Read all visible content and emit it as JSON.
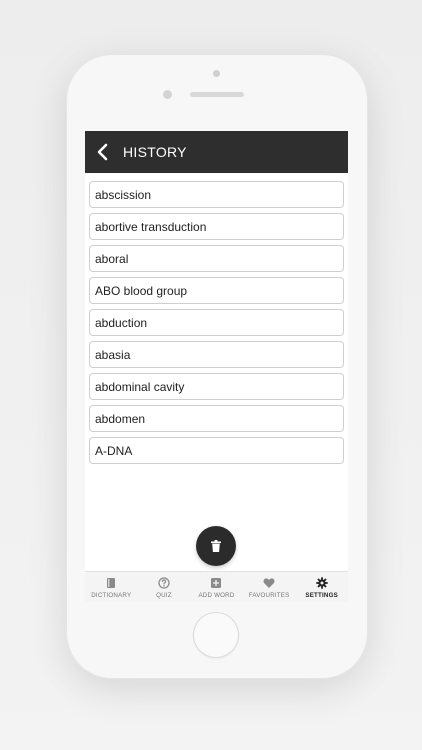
{
  "header": {
    "title": "HISTORY"
  },
  "history": [
    "abscission",
    "abortive transduction",
    "aboral",
    "ABO blood group",
    "abduction",
    "abasia",
    "abdominal cavity",
    "abdomen",
    "A-DNA"
  ],
  "tabs": [
    {
      "label": "DICTIONARY",
      "icon": "book-icon",
      "active": false
    },
    {
      "label": "QUIZ",
      "icon": "question-icon",
      "active": false
    },
    {
      "label": "ADD WORD",
      "icon": "plus-square-icon",
      "active": false
    },
    {
      "label": "FAVOURITES",
      "icon": "heart-icon",
      "active": false
    },
    {
      "label": "SETTINGS",
      "icon": "gear-icon",
      "active": true
    }
  ],
  "colors": {
    "header_bg": "#2e2e2e",
    "fab_bg": "#2b2b2b",
    "tab_inactive": "#8a8a8a",
    "tab_active": "#222222"
  }
}
